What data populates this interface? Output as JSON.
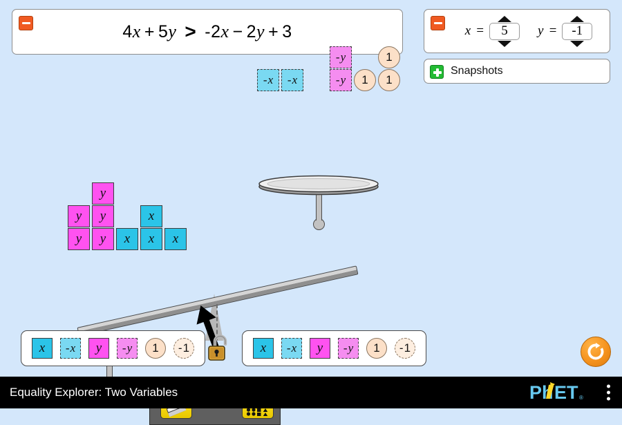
{
  "app": {
    "title": "Equality Explorer: Two Variables",
    "background_color": "#d4e7fb",
    "logo_text": "PhET"
  },
  "equation_panel": {
    "collapse_icon": "minus-icon",
    "left_side": [
      {
        "kind": "num",
        "text": "4"
      },
      {
        "kind": "var",
        "text": "x"
      },
      {
        "kind": "op",
        "text": "+"
      },
      {
        "kind": "num",
        "text": "5"
      },
      {
        "kind": "var",
        "text": "y"
      }
    ],
    "relation": ">",
    "right_side": [
      {
        "kind": "num",
        "text": "-2"
      },
      {
        "kind": "var",
        "text": "x"
      },
      {
        "kind": "op",
        "text": "−"
      },
      {
        "kind": "num",
        "text": "2"
      },
      {
        "kind": "var",
        "text": "y"
      },
      {
        "kind": "op",
        "text": "+"
      },
      {
        "kind": "num",
        "text": "3"
      }
    ],
    "full_text": "4x + 5y > -2x − 2y + 3"
  },
  "variables_panel": {
    "collapse_icon": "minus-icon",
    "variables": [
      {
        "name": "x",
        "label": "x",
        "equals": "=",
        "value": "5",
        "up_icon": "triangle-up-icon",
        "down_icon": "triangle-down-icon"
      },
      {
        "name": "y",
        "label": "y",
        "equals": "=",
        "value": "-1",
        "up_icon": "triangle-up-icon",
        "down_icon": "triangle-down-icon"
      }
    ]
  },
  "snapshots_panel": {
    "expand_icon": "plus-icon",
    "label": "Snapshots"
  },
  "scale": {
    "tilt_degrees": -12.5,
    "arrow_icon": "tilt-arrow-icon",
    "dashed_reference": "vertical-dashed-line",
    "base_buttons": [
      {
        "name": "eraser-button",
        "icon": "eraser-icon"
      },
      {
        "name": "organize-button",
        "icon": "organize-icon"
      }
    ],
    "left_plate": {
      "label": "left-plate",
      "terms": [
        {
          "name": "term-y",
          "type": "y",
          "text": "y",
          "dashed": false,
          "col": 0,
          "row": 0
        },
        {
          "name": "term-y",
          "type": "y",
          "text": "y",
          "dashed": false,
          "col": 0,
          "row": 1
        },
        {
          "name": "term-y",
          "type": "y",
          "text": "y",
          "dashed": false,
          "col": 1,
          "row": 0
        },
        {
          "name": "term-y",
          "type": "y",
          "text": "y",
          "dashed": false,
          "col": 1,
          "row": 1
        },
        {
          "name": "term-y",
          "type": "y",
          "text": "y",
          "dashed": false,
          "col": 1,
          "row": 2
        },
        {
          "name": "term-x",
          "type": "x",
          "text": "x",
          "dashed": false,
          "col": 2,
          "row": 0
        },
        {
          "name": "term-x",
          "type": "x",
          "text": "x",
          "dashed": false,
          "col": 3,
          "row": 0
        },
        {
          "name": "term-x",
          "type": "x",
          "text": "x",
          "dashed": false,
          "col": 3,
          "row": 1
        },
        {
          "name": "term-x",
          "type": "x",
          "text": "x",
          "dashed": false,
          "col": 4,
          "row": 0
        }
      ],
      "summary": "4x + 5y"
    },
    "right_plate": {
      "label": "right-plate",
      "terms": [
        {
          "name": "term-negative-x",
          "type": "nx",
          "text": "-x",
          "dashed": true,
          "col": 0,
          "row": 0
        },
        {
          "name": "term-negative-x",
          "type": "nx",
          "text": "-x",
          "dashed": true,
          "col": 1,
          "row": 0
        },
        {
          "name": "term-negative-y",
          "type": "ny",
          "text": "-y",
          "dashed": true,
          "col": 3,
          "row": 0
        },
        {
          "name": "term-negative-y",
          "type": "ny",
          "text": "-y",
          "dashed": true,
          "col": 3,
          "row": 1
        },
        {
          "name": "term-one",
          "type": "c1",
          "text": "1",
          "dashed": false,
          "col": 4,
          "row": 0
        },
        {
          "name": "term-one",
          "type": "c1",
          "text": "1",
          "dashed": false,
          "col": 5,
          "row": 0
        },
        {
          "name": "term-one",
          "type": "c1",
          "text": "1",
          "dashed": false,
          "col": 5,
          "row": 1
        }
      ],
      "summary": "-2x − 2y + 3"
    }
  },
  "toolbox_left": {
    "name": "left-terms-toolbox",
    "items": [
      {
        "name": "tool-x",
        "type": "x",
        "text": "x",
        "dashed": false
      },
      {
        "name": "tool-negative-x",
        "type": "nx",
        "text": "-x",
        "dashed": true
      },
      {
        "name": "tool-y",
        "type": "y",
        "text": "y",
        "dashed": false
      },
      {
        "name": "tool-negative-y",
        "type": "ny",
        "text": "-y",
        "dashed": true
      },
      {
        "name": "tool-one",
        "type": "c1",
        "text": "1",
        "dashed": false
      },
      {
        "name": "tool-negative-one",
        "type": "c1",
        "text": "-1",
        "dashed": true
      }
    ]
  },
  "toolbox_right": {
    "name": "right-terms-toolbox",
    "items": [
      {
        "name": "tool-x",
        "type": "x",
        "text": "x",
        "dashed": false
      },
      {
        "name": "tool-negative-x",
        "type": "nx",
        "text": "-x",
        "dashed": true
      },
      {
        "name": "tool-y",
        "type": "y",
        "text": "y",
        "dashed": false
      },
      {
        "name": "tool-negative-y",
        "type": "ny",
        "text": "-y",
        "dashed": true
      },
      {
        "name": "tool-one",
        "type": "c1",
        "text": "1",
        "dashed": false
      },
      {
        "name": "tool-negative-one",
        "type": "c1",
        "text": "-1",
        "dashed": true
      }
    ]
  },
  "lock_control": {
    "name": "lock-toggle",
    "icon": "padlock-open-icon",
    "state": "unlocked"
  },
  "reset_all": {
    "name": "reset-all-button",
    "icon": "reset-circular-arrow-icon",
    "color": "#f5931e"
  },
  "colors": {
    "x_tile": "#2bc4e8",
    "negative_x_tile": "#7ad9f2",
    "y_tile": "#ff52f0",
    "negative_y_tile": "#f58df0",
    "coin": "#fce0c8",
    "collapse_button": "#f05a22",
    "expand_button": "#22bb33",
    "reset_button": "#f5931e",
    "background": "#d4e7fb"
  }
}
